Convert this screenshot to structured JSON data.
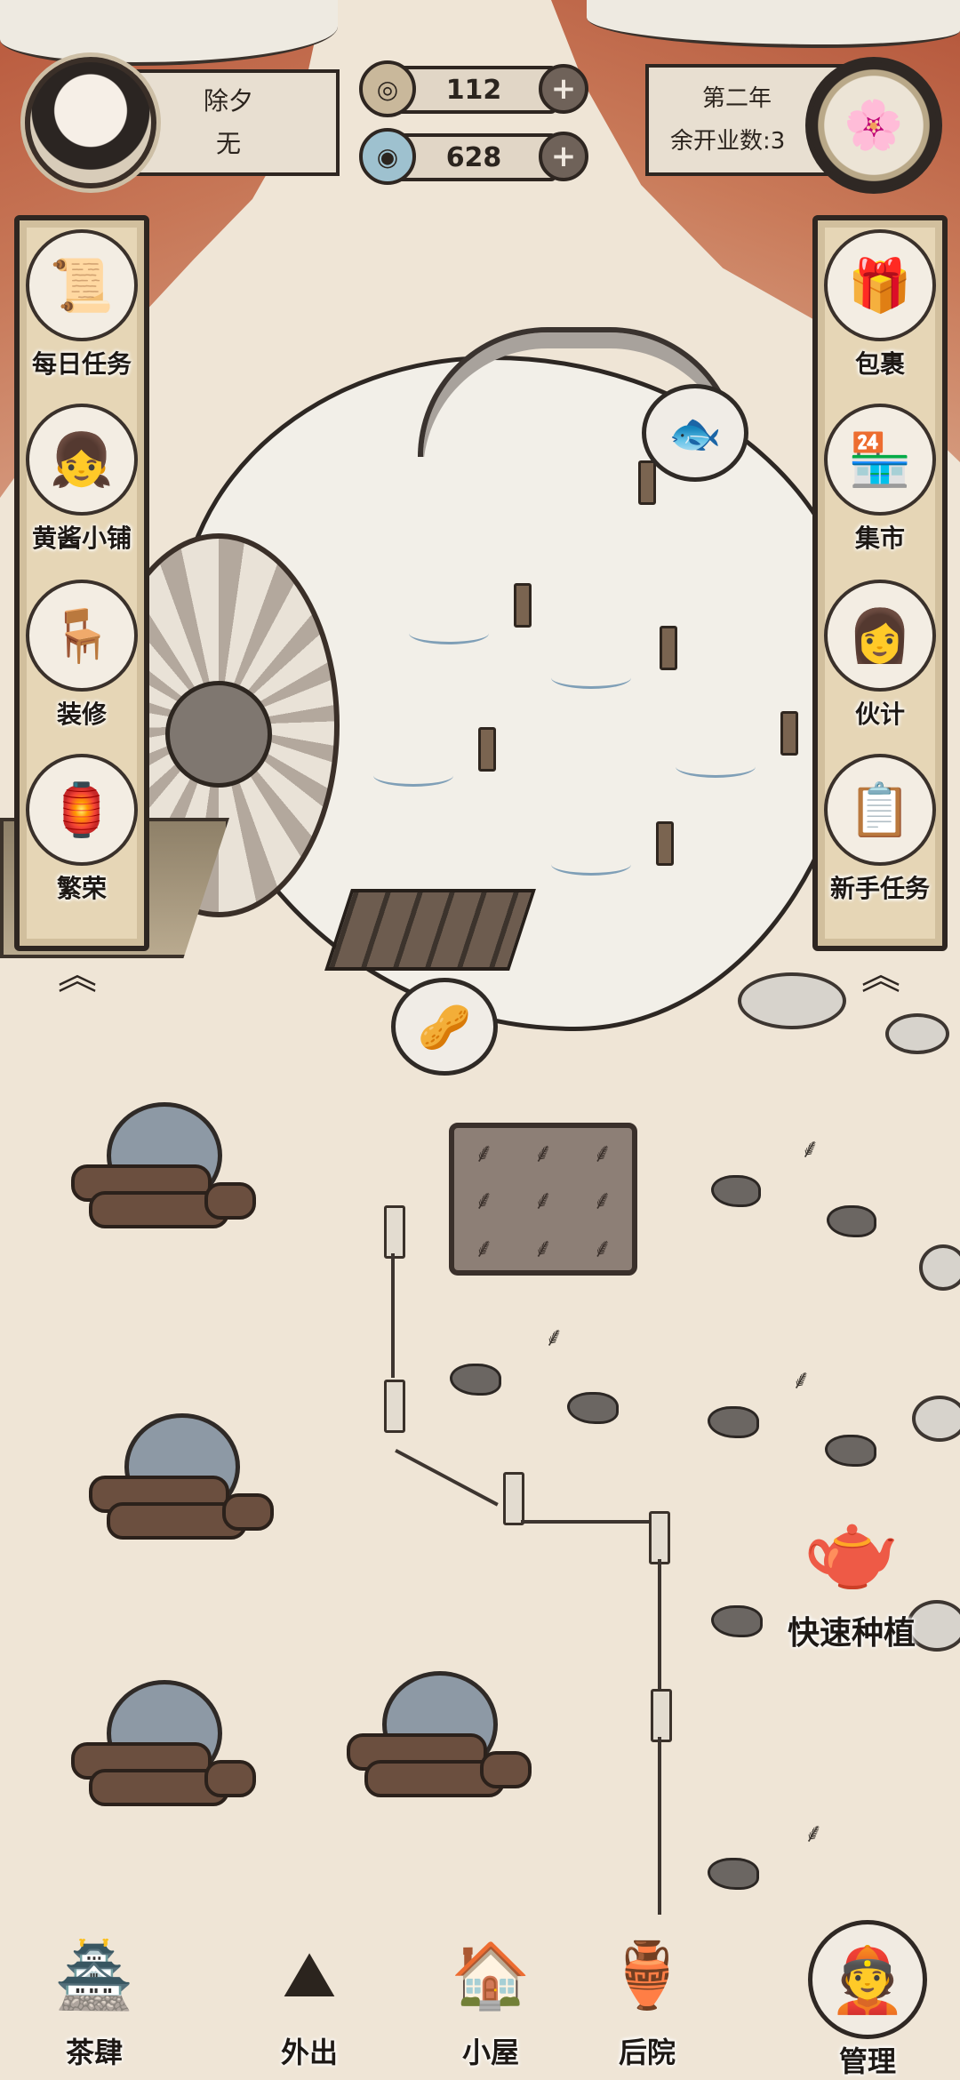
{
  "player": {
    "name": "除夕",
    "title": "无"
  },
  "resources": {
    "coins": {
      "value": "112",
      "icon": "coin-icon"
    },
    "gems": {
      "value": "628",
      "icon": "spirit-gem-icon"
    }
  },
  "status": {
    "year": "第二年",
    "remaining_business_days": "余开业数:3"
  },
  "left_menu": [
    {
      "label": "每日任务",
      "icon": "scroll-icon",
      "glyph": "📜"
    },
    {
      "label": "黄酱小铺",
      "icon": "shop-girl-icon",
      "glyph": "👧"
    },
    {
      "label": "装修",
      "icon": "furniture-icon",
      "glyph": "🪑"
    },
    {
      "label": "繁荣",
      "icon": "lantern-icon",
      "glyph": "🏮"
    }
  ],
  "right_menu": [
    {
      "label": "包裹",
      "icon": "package-icon",
      "glyph": "🎁"
    },
    {
      "label": "集市",
      "icon": "market-stall-icon",
      "glyph": "🏪"
    },
    {
      "label": "伙计",
      "icon": "helper-girl-icon",
      "glyph": "👩"
    },
    {
      "label": "新手任务",
      "icon": "quest-scroll-icon",
      "glyph": "📋"
    }
  ],
  "quick_plant": {
    "label": "快速种植",
    "icon": "watering-kettle-icon",
    "glyph": "🫖"
  },
  "bottom_nav": [
    {
      "label": "茶肆",
      "icon": "teahouse-icon",
      "glyph": "🏯"
    },
    {
      "label": "外出",
      "icon": "travel-icon",
      "glyph": "⛰"
    },
    {
      "label": "小屋",
      "icon": "cottage-icon",
      "glyph": "🏠"
    },
    {
      "label": "后院",
      "icon": "backyard-icon",
      "glyph": "🏺"
    },
    {
      "label": "管理",
      "icon": "manager-icon",
      "glyph": "👲"
    }
  ],
  "glyphs": {
    "plus": "+",
    "collapse": "︽",
    "coin": "◎",
    "gem": "◉",
    "season": "🌸",
    "fish": "🐟",
    "food": "🥜"
  }
}
